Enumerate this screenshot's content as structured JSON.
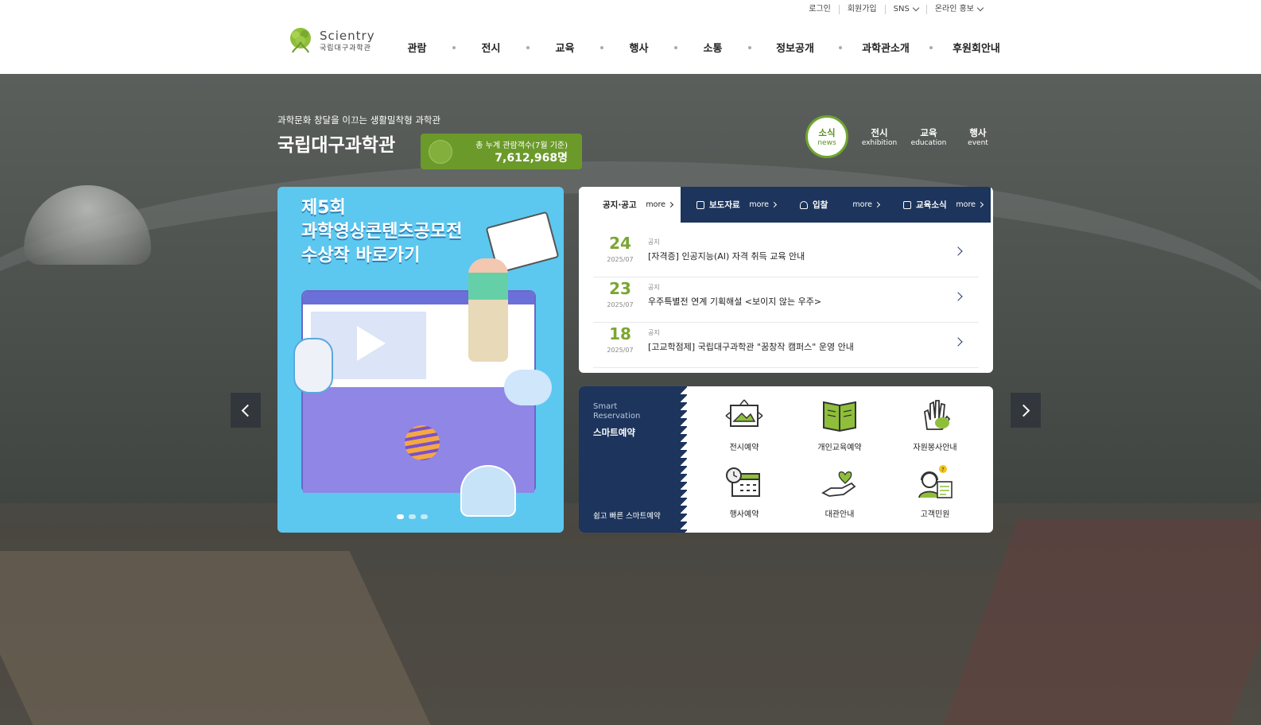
{
  "util": {
    "login": "로그인",
    "join": "회원가입",
    "sns": "SNS",
    "promo": "온라인 홍보"
  },
  "logo": {
    "en": "Scientry",
    "ko": "국립대구과학관"
  },
  "gnb": [
    "관람",
    "전시",
    "교육",
    "행사",
    "소통",
    "정보공개",
    "과학관소개",
    "후원회안내"
  ],
  "hero": {
    "tagline": "과학문화 창달을 이끄는 생활밀착형 과학관",
    "title": "국립대구과학관",
    "visitor_label": "총 누계 관람객수(7월 기준)",
    "visitor_count": "7,612,968명"
  },
  "categories": [
    {
      "ko": "소식",
      "en": "news"
    },
    {
      "ko": "전시",
      "en": "exhibition"
    },
    {
      "ko": "교육",
      "en": "education"
    },
    {
      "ko": "행사",
      "en": "event"
    }
  ],
  "banner": {
    "line1": "제5회",
    "line2": "과학영상콘텐츠공모전",
    "line3": "수상작 바로가기"
  },
  "board": {
    "tabs": [
      {
        "label": "공지·공고",
        "more": "more"
      },
      {
        "label": "보도자료",
        "more": "more"
      },
      {
        "label": "입찰",
        "more": "more"
      },
      {
        "label": "교육소식",
        "more": "more"
      }
    ],
    "items": [
      {
        "day": "24",
        "ym": "2025/07",
        "category": "공지",
        "title": "[자격증] 인공지능(AI) 자격 취득 교육 안내"
      },
      {
        "day": "23",
        "ym": "2025/07",
        "category": "공지",
        "title": "우주특별전 연계 기획해설 <보이지 않는 우주>"
      },
      {
        "day": "18",
        "ym": "2025/07",
        "category": "공지",
        "title": "[고교학점제] 국립대구과학관 \"꿈창작 캠퍼스\" 운영 안내"
      }
    ]
  },
  "smart": {
    "en": "Smart Reservation",
    "ko": "스마트예약",
    "sub": "쉽고 빠른 스마트예약",
    "items": [
      {
        "label": "전시예약",
        "icon": "exhibition-icon"
      },
      {
        "label": "개인교육예약",
        "icon": "book-icon"
      },
      {
        "label": "자원봉사안내",
        "icon": "hand-icon"
      },
      {
        "label": "행사예약",
        "icon": "calendar-icon"
      },
      {
        "label": "대관안내",
        "icon": "heart-hand-icon"
      },
      {
        "label": "고객민원",
        "icon": "headset-icon"
      }
    ]
  },
  "colors": {
    "accent_green": "#6b9a2a",
    "navy": "#1d355c"
  }
}
